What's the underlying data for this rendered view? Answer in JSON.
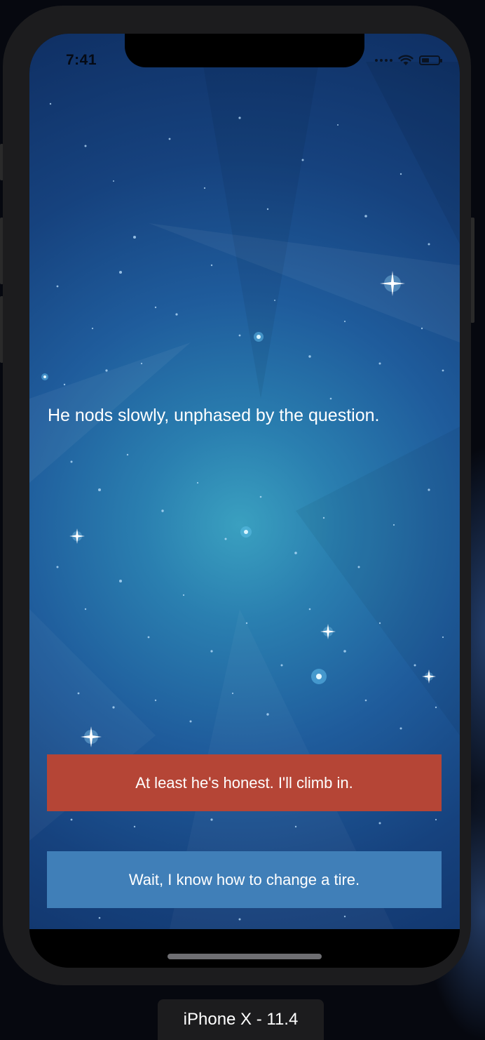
{
  "status_bar": {
    "time": "7:41",
    "icons": [
      "cellular-signal-icon",
      "wifi-icon",
      "battery-icon"
    ]
  },
  "story": {
    "text": "He nods slowly, unphased by the question."
  },
  "choices": [
    {
      "label": "At least he's honest. I'll climb in.",
      "color": "#b54536"
    },
    {
      "label": "Wait, I know how to change a tire.",
      "color": "#407fb8"
    }
  ],
  "simulator": {
    "device_label": "iPhone X - 11.4"
  },
  "colors": {
    "scene_center": "#3aa0c0",
    "scene_edge": "#0f2f63",
    "device_frame": "#1c1c1e"
  }
}
